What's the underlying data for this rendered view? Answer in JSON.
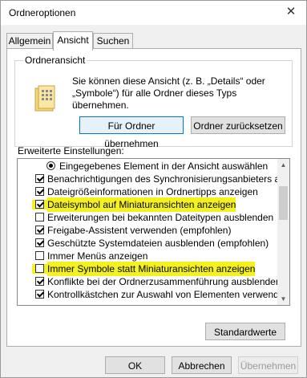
{
  "window": {
    "title": "Ordneroptionen",
    "close_glyph": "✕"
  },
  "tabs": [
    {
      "label": "Allgemein",
      "active": false
    },
    {
      "label": "Ansicht",
      "active": true
    },
    {
      "label": "Suchen",
      "active": false
    }
  ],
  "folder_view": {
    "label": "Ordneransicht",
    "line1": "Sie können diese Ansicht (z. B. „Details“ oder",
    "line2": "„Symbole“) für alle Ordner dieses Typs übernehmen.",
    "apply_button": "Für Ordner übernehmen",
    "reset_button": "Ordner zurücksetzen",
    "icon": "folder-icon"
  },
  "advanced": {
    "label": "Erweiterte Einstellungen:",
    "items": [
      {
        "kind": "radio",
        "text": "Eingegebenes Element in der Ansicht auswählen",
        "checked": true,
        "highlight": false
      },
      {
        "kind": "checkbox",
        "text": "Benachrichtigungen des Synchronisierungsanbieters anzeigen",
        "checked": true,
        "highlight": false
      },
      {
        "kind": "checkbox",
        "text": "Dateigrößeinformationen in Ordnertipps anzeigen",
        "checked": true,
        "highlight": false
      },
      {
        "kind": "checkbox",
        "text": "Dateisymbol auf Miniaturansichten anzeigen",
        "checked": true,
        "highlight": true
      },
      {
        "kind": "checkbox",
        "text": "Erweiterungen bei bekannten Dateitypen ausblenden",
        "checked": false,
        "highlight": false
      },
      {
        "kind": "checkbox",
        "text": "Freigabe-Assistent verwenden (empfohlen)",
        "checked": true,
        "highlight": false
      },
      {
        "kind": "checkbox",
        "text": "Geschützte Systemdateien ausblenden (empfohlen)",
        "checked": true,
        "highlight": false
      },
      {
        "kind": "checkbox",
        "text": "Immer Menüs anzeigen",
        "checked": false,
        "highlight": false
      },
      {
        "kind": "checkbox",
        "text": "Immer Symbole statt Miniaturansichten anzeigen",
        "checked": false,
        "highlight": true
      },
      {
        "kind": "checkbox",
        "text": "Konflikte bei der Ordnerzusammenführung ausblenden",
        "checked": true,
        "highlight": false
      },
      {
        "kind": "checkbox",
        "text": "Kontrollkästchen zur Auswahl von Elementen verwenden",
        "checked": true,
        "highlight": false
      }
    ],
    "highlight_color": "#f5f11e"
  },
  "buttons": {
    "defaults": "Standardwerte",
    "ok": "OK",
    "cancel": "Abbrechen",
    "apply": "Übernehmen"
  }
}
